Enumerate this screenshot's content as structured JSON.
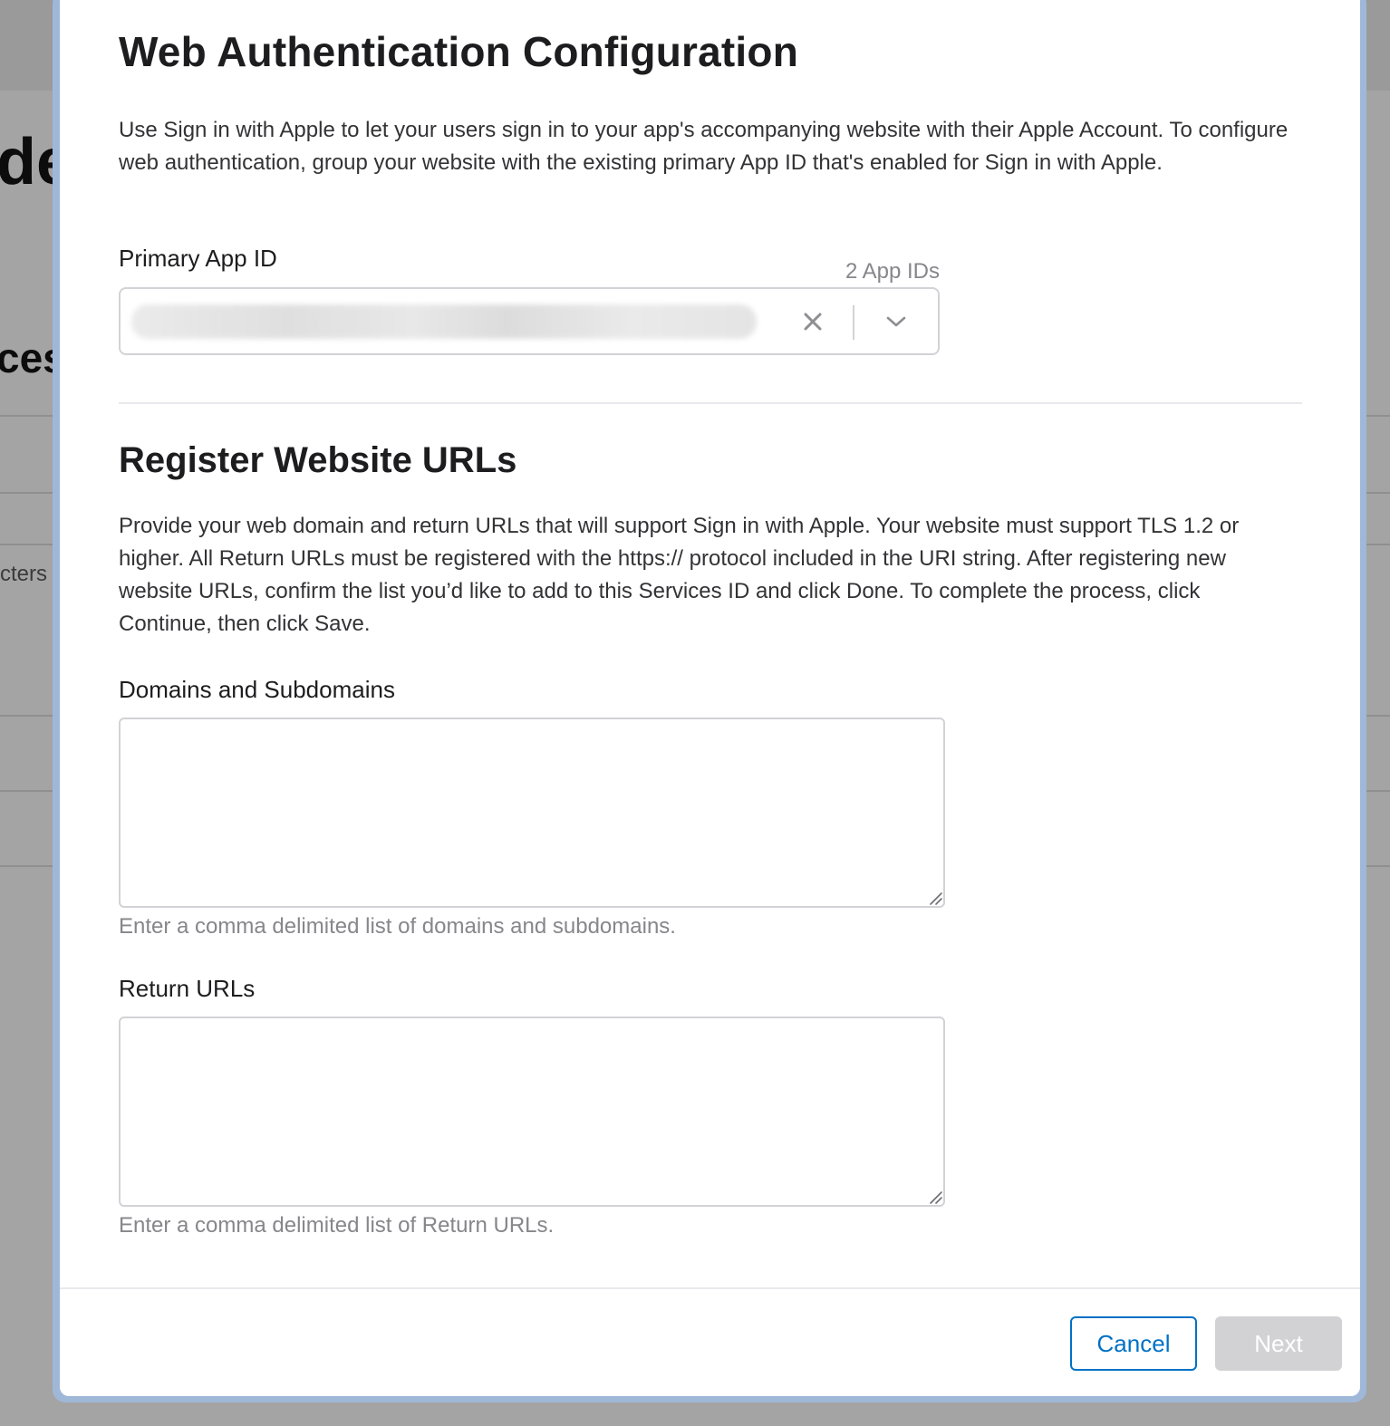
{
  "background": {
    "heading_fragment_1": "de",
    "heading_fragment_2": "ces",
    "text_fragment": "cters s"
  },
  "modal": {
    "title": "Web Authentication Configuration",
    "intro": "Use Sign in with Apple to let your users sign in to your app's accompanying website with their Apple Account. To configure web authentication, group your website with the existing primary App ID that's enabled for Sign in with Apple.",
    "primary_app_id": {
      "label": "Primary App ID",
      "count": "2 App IDs"
    },
    "register": {
      "title": "Register Website URLs",
      "description": "Provide your web domain and return URLs that will support Sign in with Apple. Your website must support TLS 1.2 or higher. All Return URLs must be registered with the https:// protocol included in the URI string. After registering new website URLs, confirm the list you’d like to add to this Services ID and click Done. To complete the process, click Continue, then click Save."
    },
    "domains": {
      "label": "Domains and Subdomains",
      "value": "",
      "hint": "Enter a comma delimited list of domains and subdomains."
    },
    "return_urls": {
      "label": "Return URLs",
      "value": "",
      "hint": "Enter a comma delimited list of Return URLs."
    },
    "footer": {
      "cancel_label": "Cancel",
      "next_label": "Next"
    }
  },
  "colors": {
    "accent": "#0071c4",
    "disabled_button": "#d2d2d4",
    "overlay": "#a4a4a4"
  },
  "icons": {
    "clear": "close-icon",
    "dropdown": "chevron-down-icon",
    "resize": "resize-grip-icon"
  }
}
